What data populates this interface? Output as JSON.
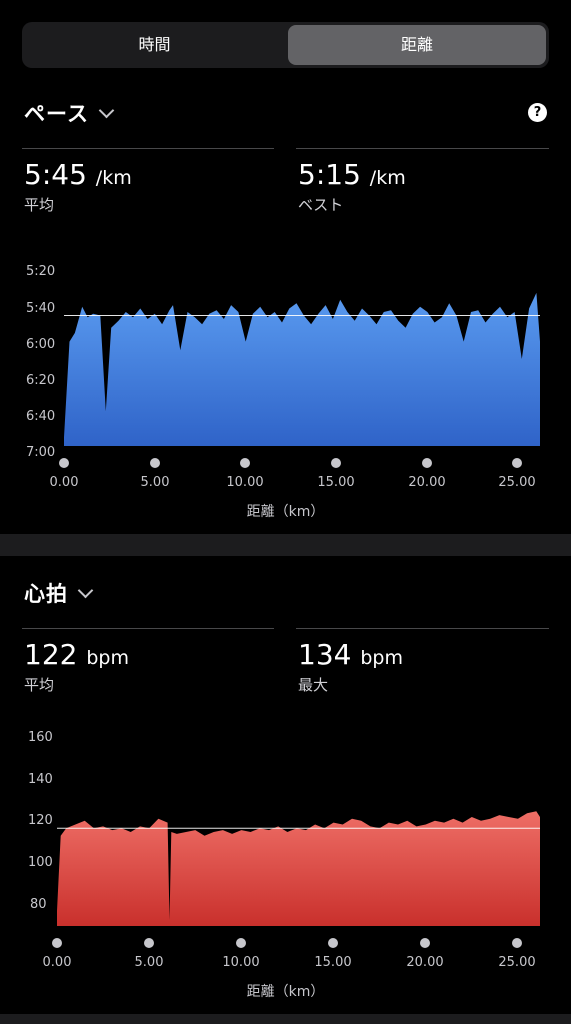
{
  "tabs": {
    "time": "時間",
    "distance": "距離",
    "selected": "distance"
  },
  "pace": {
    "title": "ペース",
    "help": "?",
    "avg_value": "5:45",
    "avg_unit": "/km",
    "avg_label": "平均",
    "best_value": "5:15",
    "best_unit": "/km",
    "best_label": "ベスト"
  },
  "heart": {
    "title": "心拍",
    "avg_value": "122",
    "avg_unit": "bpm",
    "avg_label": "平均",
    "max_value": "134",
    "max_unit": "bpm",
    "max_label": "最大"
  },
  "colors": {
    "pace_fill_top": "#5a9bf0",
    "pace_fill_bottom": "#2f63c8",
    "hr_fill_top": "#ee6e66",
    "hr_fill_bottom": "#c9302c"
  },
  "chart_data": [
    {
      "type": "area",
      "xlabel": "距離（km）",
      "ylabel": "",
      "x_ticks": [
        "0.00",
        "5.00",
        "10.00",
        "15.00",
        "20.00",
        "25.00"
      ],
      "y_ticks": [
        "5:20",
        "5:40",
        "6:00",
        "6:20",
        "6:40",
        "7:00"
      ],
      "y_inverted": true,
      "ylim_seconds": [
        320,
        420
      ],
      "xlim": [
        0,
        26.2
      ],
      "average_line_seconds": 345,
      "series": [
        {
          "x": [
            0,
            0.3,
            0.6,
            1.0,
            1.3,
            1.6,
            2.0,
            2.3,
            2.6,
            3.0,
            3.4,
            3.8,
            4.2,
            4.6,
            5.0,
            5.4,
            5.8,
            6.0,
            6.4,
            6.8,
            7.2,
            7.6,
            8.0,
            8.4,
            8.8,
            9.2,
            9.6,
            10.0,
            10.4,
            10.8,
            11.2,
            11.6,
            12.0,
            12.4,
            12.8,
            13.2,
            13.6,
            14.0,
            14.4,
            14.8,
            15.2,
            15.6,
            16.0,
            16.4,
            16.8,
            17.2,
            17.6,
            18.0,
            18.4,
            18.8,
            19.2,
            19.6,
            20.0,
            20.4,
            20.8,
            21.2,
            21.6,
            22.0,
            22.4,
            22.8,
            23.2,
            23.6,
            24.0,
            24.4,
            24.8,
            25.2,
            25.6,
            26.0,
            26.2
          ],
          "y": [
            415,
            360,
            355,
            340,
            346,
            344,
            345,
            400,
            352,
            348,
            343,
            346,
            341,
            347,
            344,
            350,
            342,
            339,
            365,
            343,
            346,
            350,
            344,
            342,
            347,
            339,
            343,
            360,
            344,
            340,
            346,
            343,
            349,
            341,
            338,
            345,
            350,
            344,
            339,
            347,
            336,
            343,
            348,
            341,
            345,
            350,
            343,
            342,
            348,
            352,
            344,
            340,
            343,
            349,
            346,
            338,
            345,
            360,
            343,
            342,
            349,
            344,
            340,
            346,
            343,
            370,
            341,
            332,
            360
          ],
          "values_unit": "seconds per km"
        }
      ]
    },
    {
      "type": "area",
      "xlabel": "距離（km）",
      "ylabel": "",
      "x_ticks": [
        "0.00",
        "5.00",
        "10.00",
        "15.00",
        "20.00",
        "25.00"
      ],
      "y_ticks": [
        "160",
        "140",
        "120",
        "100",
        "80"
      ],
      "ylim": [
        70,
        170
      ],
      "xlim": [
        0,
        26.2
      ],
      "average_line": 122,
      "series": [
        {
          "x": [
            0,
            0.2,
            0.5,
            1.0,
            1.5,
            2.0,
            2.5,
            3.0,
            3.5,
            4.0,
            4.5,
            5.0,
            5.5,
            6.0,
            6.1,
            6.2,
            6.5,
            7.0,
            7.5,
            8.0,
            8.5,
            9.0,
            9.5,
            10.0,
            10.5,
            11.0,
            11.5,
            12.0,
            12.5,
            13.0,
            13.5,
            14.0,
            14.5,
            15.0,
            15.5,
            16.0,
            16.5,
            17.0,
            17.5,
            18.0,
            18.5,
            19.0,
            19.5,
            20.0,
            20.5,
            21.0,
            21.5,
            22.0,
            22.5,
            23.0,
            23.5,
            24.0,
            24.5,
            25.0,
            25.5,
            26.0,
            26.2
          ],
          "y": [
            78,
            118,
            122,
            124,
            126,
            122,
            123,
            121,
            122,
            120,
            123,
            122,
            127,
            125,
            73,
            120,
            119,
            120,
            121,
            118,
            120,
            121,
            119,
            121,
            120,
            122,
            121,
            123,
            120,
            122,
            121,
            124,
            122,
            125,
            124,
            127,
            126,
            123,
            122,
            125,
            124,
            126,
            123,
            124,
            126,
            125,
            127,
            125,
            128,
            126,
            127,
            129,
            128,
            127,
            130,
            131,
            128
          ]
        }
      ]
    }
  ]
}
